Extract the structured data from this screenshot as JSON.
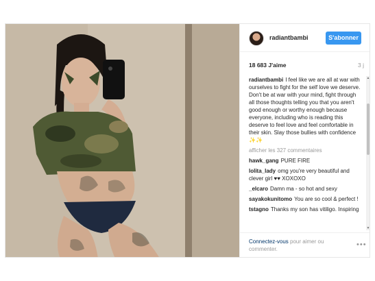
{
  "header": {
    "username": "radiantbambi",
    "follow_label": "S'abonner"
  },
  "stats": {
    "likes": "18 683 J'aime",
    "age": "3 j"
  },
  "caption": {
    "user": "radiantbambi",
    "text": "I feel like we are all at war with ourselves to fight for the self love we deserve. Don't be at war with your mind, fight through all those thoughts telling you that you aren't good enough or worthy enough because everyone, including who is reading this deserve to feel love and feel comfortable in their skin. Slay those bullies with confidence",
    "trailing": "✨✨"
  },
  "view_more": "afficher les 327 commentaires",
  "comments": [
    {
      "user": "hawk_gang",
      "text": "PURE FIRE"
    },
    {
      "user": "lolita_lady",
      "text": "omg you're very beautiful and clever girl ♥♥ XOXOXO"
    },
    {
      "user": "_elcaro",
      "text": "Damn ma - so hot and sexy"
    },
    {
      "user": "sayakokunitomo",
      "text": "You are so cool & perfect !"
    },
    {
      "user": "tstagno",
      "text": "Thanks my son has vitiligo. Inspiring"
    }
  ],
  "footer": {
    "login_link": "Connectez-vous",
    "login_rest": " pour aimer ou commenter.",
    "more_icon": "ellipsis-icon"
  },
  "colors": {
    "follow_button": "#3897f0",
    "link": "#003569",
    "muted": "#999999"
  }
}
